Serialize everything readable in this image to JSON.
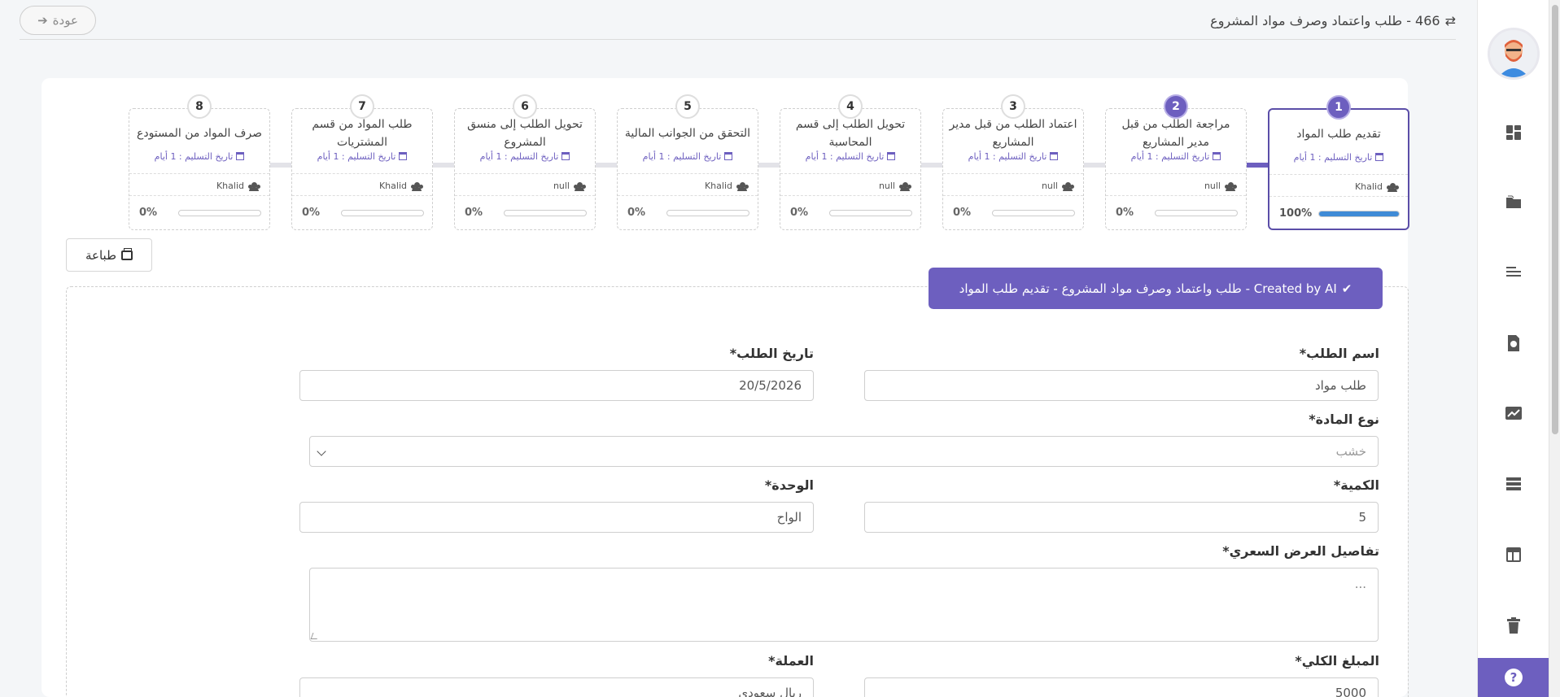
{
  "header": {
    "title": "466 - طلب واعتماد وصرف مواد المشروع",
    "back_label": "عودة"
  },
  "stepper": [
    {
      "num": "1",
      "title": "تقديم طلب المواد",
      "date": "تاريخ التسليم : 1 أيام",
      "user": "Khalid",
      "progress": "100%",
      "fill": 1.0,
      "state": "active"
    },
    {
      "num": "2",
      "title": "مراجعة الطلب من قبل مدير المشاريع",
      "date": "تاريخ التسليم : 1 أيام",
      "user": "null",
      "progress": "0%",
      "fill": 0,
      "state": "current"
    },
    {
      "num": "3",
      "title": "اعتماد الطلب من قبل مدير المشاريع",
      "date": "تاريخ التسليم : 1 أيام",
      "user": "null",
      "progress": "0%",
      "fill": 0,
      "state": ""
    },
    {
      "num": "4",
      "title": "تحويل الطلب إلى قسم المحاسبة",
      "date": "تاريخ التسليم : 1 أيام",
      "user": "null",
      "progress": "0%",
      "fill": 0,
      "state": ""
    },
    {
      "num": "5",
      "title": "التحقق من الجوانب المالية",
      "date": "تاريخ التسليم : 1 أيام",
      "user": "Khalid",
      "progress": "0%",
      "fill": 0,
      "state": ""
    },
    {
      "num": "6",
      "title": "تحويل الطلب إلى منسق المشروع",
      "date": "تاريخ التسليم : 1 أيام",
      "user": "null",
      "progress": "0%",
      "fill": 0,
      "state": ""
    },
    {
      "num": "7",
      "title": "طلب المواد من قسم المشتريات",
      "date": "تاريخ التسليم : 1 أيام",
      "user": "Khalid",
      "progress": "0%",
      "fill": 0,
      "state": ""
    },
    {
      "num": "8",
      "title": "صرف المواد من المستودع",
      "date": "تاريخ التسليم : 1 أيام",
      "user": "Khalid",
      "progress": "0%",
      "fill": 0,
      "state": ""
    }
  ],
  "print_label": "طباعة",
  "form": {
    "header": "Created by AI - طلب واعتماد وصرف مواد المشروع - تقديم طلب المواد",
    "request_name_label": "اسم الطلب*",
    "request_name_value": "طلب مواد",
    "request_date_label": "تاريخ الطلب*",
    "request_date_value": "20/5/2026",
    "material_type_label": "نوع المادة*",
    "material_type_value": "خشب",
    "quantity_label": "الكمية*",
    "quantity_value": "5",
    "unit_label": "الوحدة*",
    "unit_value": "الواح",
    "quote_details_label": "تفاصيل العرض السعري*",
    "quote_details_value": "...",
    "total_label": "المبلغ الكلي*",
    "total_value": "5000",
    "currency_label": "العملة*",
    "currency_value": "ريال سعودي"
  },
  "sidebar": {
    "icons": [
      "dashboard-icon",
      "folder-icon",
      "align-icon",
      "file-star-icon",
      "chart-icon",
      "list-icon",
      "table-icon",
      "trash-icon"
    ],
    "help_label": "?"
  },
  "colors": {
    "accent": "#6d5fbf",
    "progress": "#3f8bd6"
  }
}
